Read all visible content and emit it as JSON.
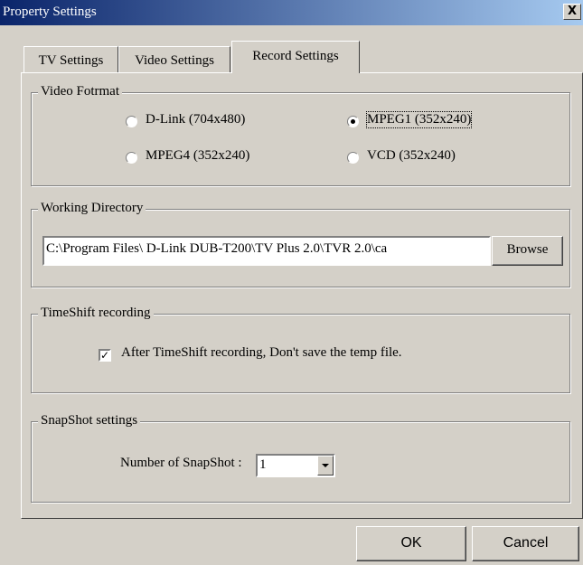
{
  "window": {
    "title": "Property Settings",
    "close_symbol": "X"
  },
  "tabs": [
    {
      "label": "TV Settings",
      "active": false
    },
    {
      "label": "Video Settings",
      "active": false
    },
    {
      "label": "Record Settings",
      "active": true
    }
  ],
  "video_format": {
    "legend": "Video Fotrmat",
    "options": [
      {
        "label": "D-Link (704x480)",
        "selected": false
      },
      {
        "label": "MPEG1 (352x240)",
        "selected": true
      },
      {
        "label": "MPEG4 (352x240)",
        "selected": false
      },
      {
        "label": "VCD (352x240)",
        "selected": false
      }
    ]
  },
  "working_directory": {
    "legend": "Working Directory",
    "path": "C:\\Program Files\\ D-Link DUB-T200\\TV Plus 2.0\\TVR 2.0\\ca",
    "browse_label": "Browse"
  },
  "timeshift": {
    "legend": "TimeShift recording",
    "checkbox_label": "After TimeShift recording, Don't save the temp file.",
    "checked": true
  },
  "snapshot": {
    "legend": "SnapShot settings",
    "label": "Number of SnapShot :",
    "value": "1"
  },
  "footer": {
    "ok_label": "OK",
    "cancel_label": "Cancel"
  }
}
